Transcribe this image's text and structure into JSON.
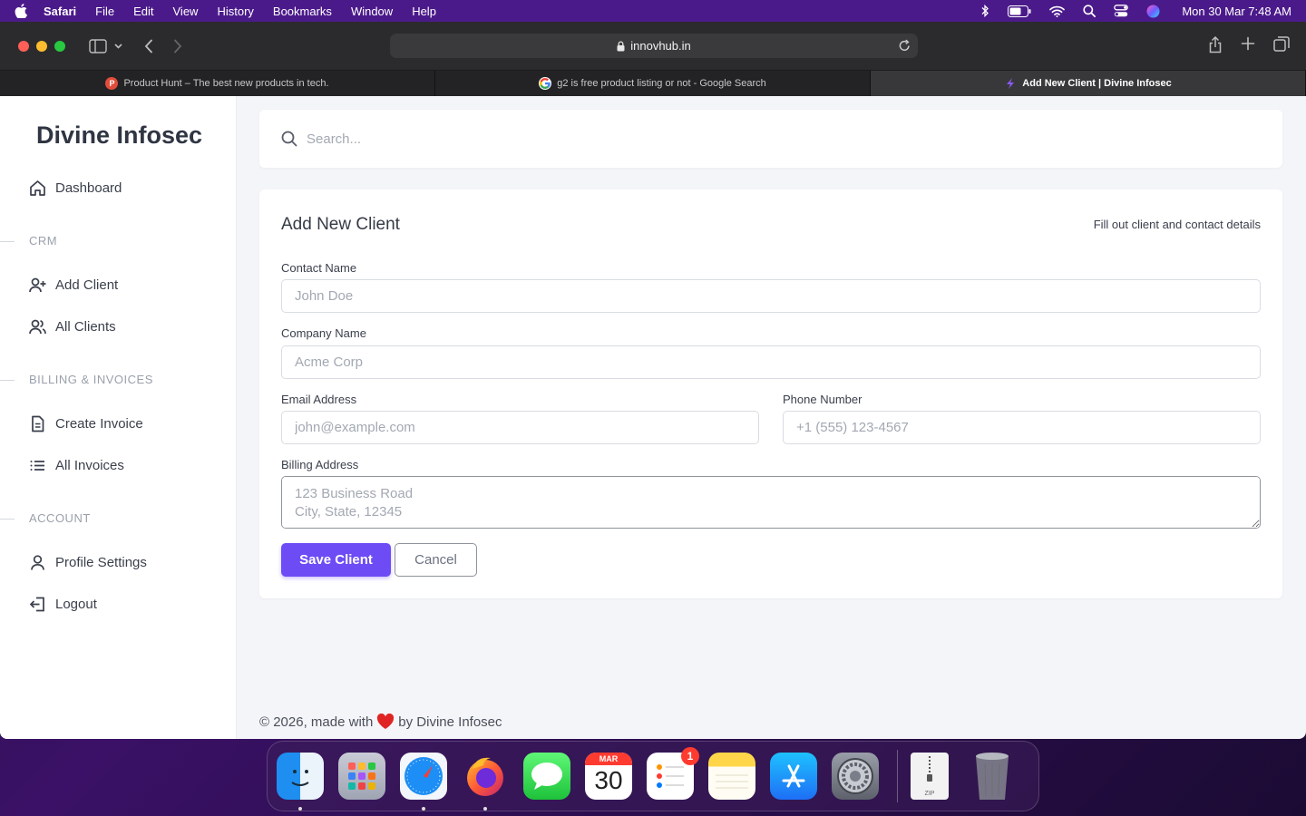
{
  "menubar": {
    "app": "Safari",
    "items": [
      "File",
      "Edit",
      "View",
      "History",
      "Bookmarks",
      "Window",
      "Help"
    ],
    "clock": "Mon 30 Mar  7:48 AM"
  },
  "browser": {
    "url": "innovhub.in",
    "tabs": [
      {
        "title": "Product Hunt – The best new products in tech.",
        "favicon_letter": "P"
      },
      {
        "title": "g2 is free product listing or not - Google Search",
        "favicon_letter": "G"
      },
      {
        "title": "Add New Client | Divine Infosec"
      }
    ]
  },
  "sidebar": {
    "brand": "Divine Infosec",
    "dashboard": "Dashboard",
    "sections": {
      "crm": "CRM",
      "billing": "BILLING & INVOICES",
      "account": "ACCOUNT"
    },
    "items": {
      "add_client": "Add Client",
      "all_clients": "All Clients",
      "create_invoice": "Create Invoice",
      "all_invoices": "All Invoices",
      "profile_settings": "Profile Settings",
      "logout": "Logout"
    }
  },
  "search": {
    "placeholder": "Search..."
  },
  "form": {
    "title": "Add New Client",
    "subtitle": "Fill out client and contact details",
    "contact_name": {
      "label": "Contact Name",
      "placeholder": "John Doe"
    },
    "company_name": {
      "label": "Company Name",
      "placeholder": "Acme Corp"
    },
    "email": {
      "label": "Email Address",
      "placeholder": "john@example.com"
    },
    "phone": {
      "label": "Phone Number",
      "placeholder": "+1 (555) 123-4567"
    },
    "billing_address": {
      "label": "Billing Address",
      "placeholder": "123 Business Road\nCity, State, 12345"
    },
    "save_label": "Save Client",
    "cancel_label": "Cancel"
  },
  "footer": {
    "prefix": "© 2026, made with",
    "suffix": "by Divine Infosec"
  },
  "dock": {
    "calendar_month": "MAR",
    "calendar_day": "30",
    "reminders_badge": "1",
    "zip_label": "ZIP"
  },
  "colors": {
    "accent": "#6d4cf5",
    "menubar": "#4b1a8a",
    "page_bg": "#f4f5f9"
  }
}
